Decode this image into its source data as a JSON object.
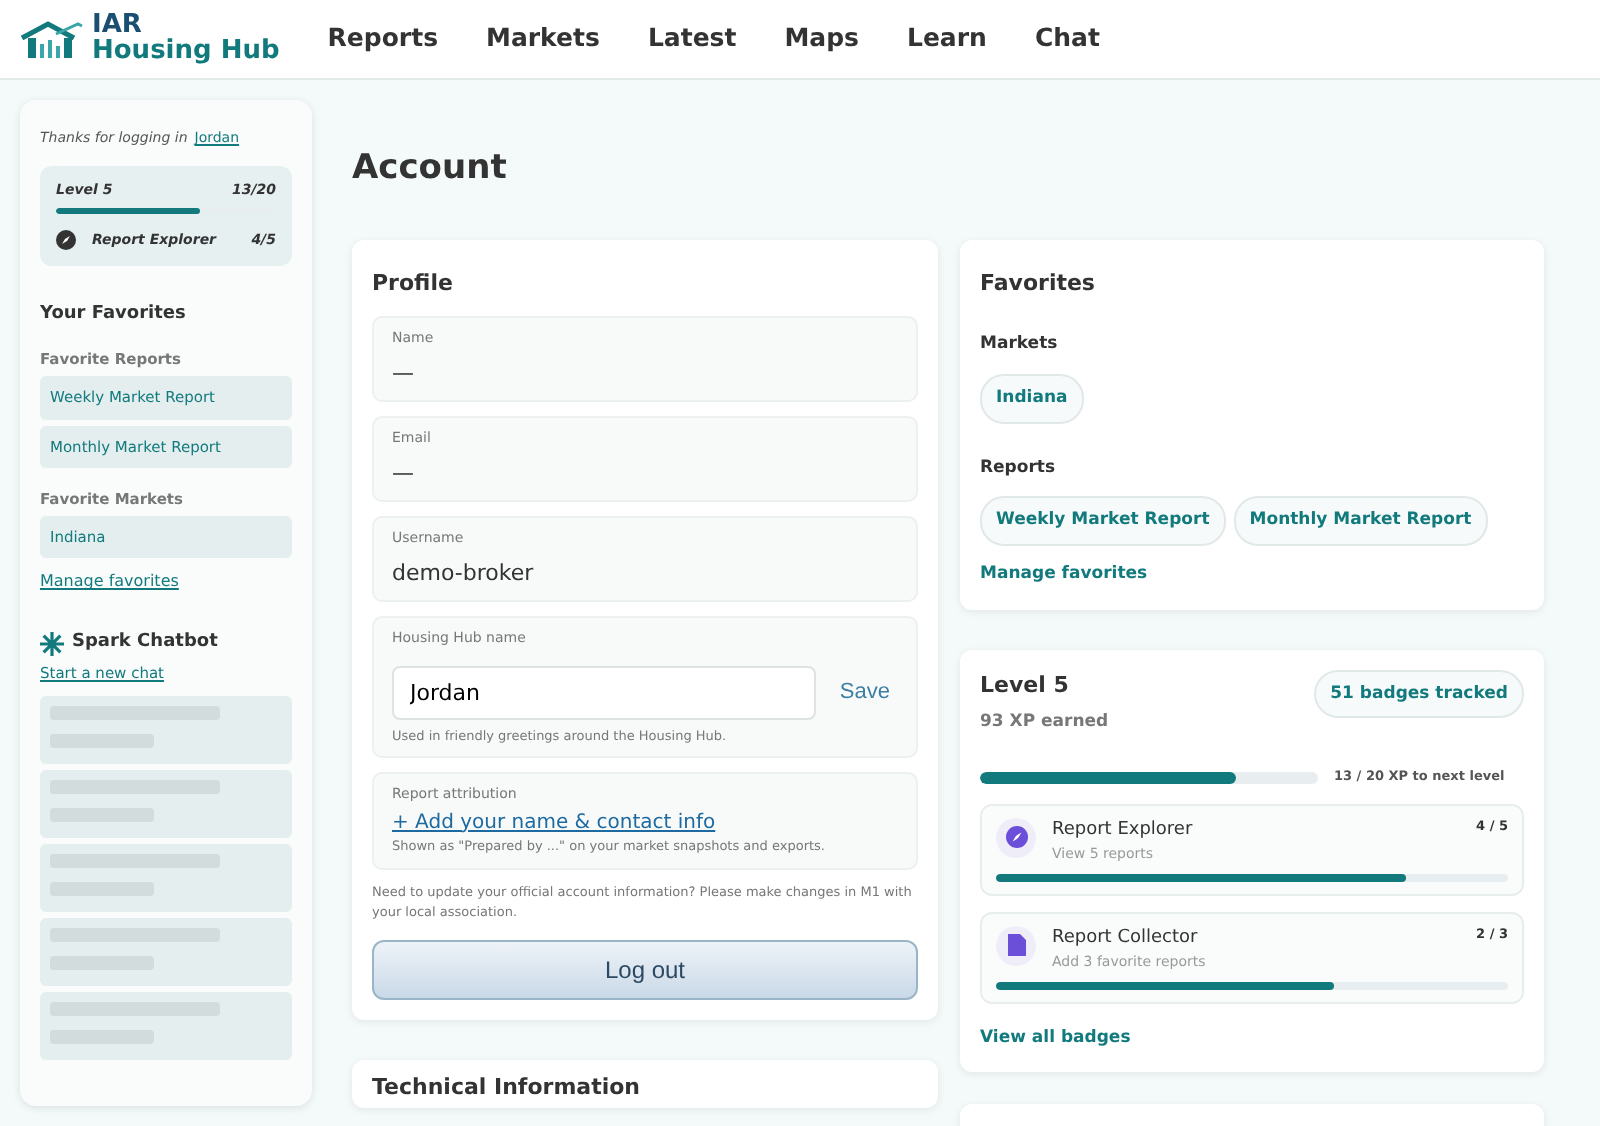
{
  "brand": {
    "line_1": "IAR",
    "line_2": "Housing Hub"
  },
  "nav": [
    {
      "label": "Reports"
    },
    {
      "label": "Markets"
    },
    {
      "label": "Latest"
    },
    {
      "label": "Maps"
    },
    {
      "label": "Learn"
    },
    {
      "label": "Chat"
    }
  ],
  "sidebar": {
    "greeting": "Thanks for logging in",
    "user_link": "Jordan",
    "level": {
      "label": "Level 5",
      "count": "13/20",
      "level": 0.65
    },
    "badge": {
      "label": "Report Explorer",
      "count": "4/5"
    },
    "favorites_title": "Your Favorites",
    "groups": [
      {
        "title": "Favorite Reports",
        "items": [
          "Weekly Market Report",
          "Monthly Market Report"
        ]
      },
      {
        "title": "Favorite Markets",
        "items": [
          "Indiana"
        ]
      }
    ],
    "manage_link": "Manage favorites",
    "chatbot_title": "Spark Chatbot",
    "new_chat_link": "Start a new chat",
    "chat_history": [
      {
        "kind": "skeleton"
      },
      {
        "kind": "skeleton"
      },
      {
        "kind": "skeleton"
      },
      {
        "kind": "skeleton"
      },
      {
        "kind": "skeleton"
      }
    ]
  },
  "page_title": "Account",
  "profile": {
    "title": "Profile",
    "fields": [
      {
        "kind": "readonly",
        "label": "Name",
        "value": "—"
      },
      {
        "kind": "readonly",
        "label": "Email",
        "value": "—"
      },
      {
        "kind": "readonly",
        "label": "Username",
        "value": "demo-broker"
      },
      {
        "kind": "editable",
        "label": "Housing Hub name",
        "value": "Jordan",
        "action": "Save",
        "help": "Used in friendly greetings around the Housing Hub."
      },
      {
        "kind": "link",
        "label": "Report attribution",
        "value": "+ Add your name & contact info",
        "help": "Shown as \"Prepared by ...\" on your market snapshots and exports."
      }
    ],
    "note": "Need to update your official account information? Please make changes in M1 with your local association.",
    "logout": "Log out"
  },
  "favorites": {
    "title": "Favorites",
    "groups": [
      {
        "title": "Markets",
        "items": [
          "Indiana"
        ]
      },
      {
        "title": "Reports",
        "items": [
          "Weekly Market Report",
          "Monthly Market Report"
        ]
      }
    ],
    "manage_link": "Manage favorites"
  },
  "level_card": {
    "title": "Level 5",
    "xp": "93 XP earned",
    "badges_tracked": "51 badges tracked",
    "level": 0.76,
    "progress_text": "13 / 20 XP to next level",
    "badges": [
      {
        "kind": "explorer",
        "name": "Report Explorer",
        "desc": "View 5 reports",
        "count": "4 / 5",
        "level": 0.8
      },
      {
        "kind": "collector",
        "name": "Report Collector",
        "desc": "Add 3 favorite reports",
        "count": "2 / 3",
        "level": 0.66
      }
    ],
    "view_all": "View all badges"
  },
  "technical": {
    "title": "Technical Information"
  }
}
